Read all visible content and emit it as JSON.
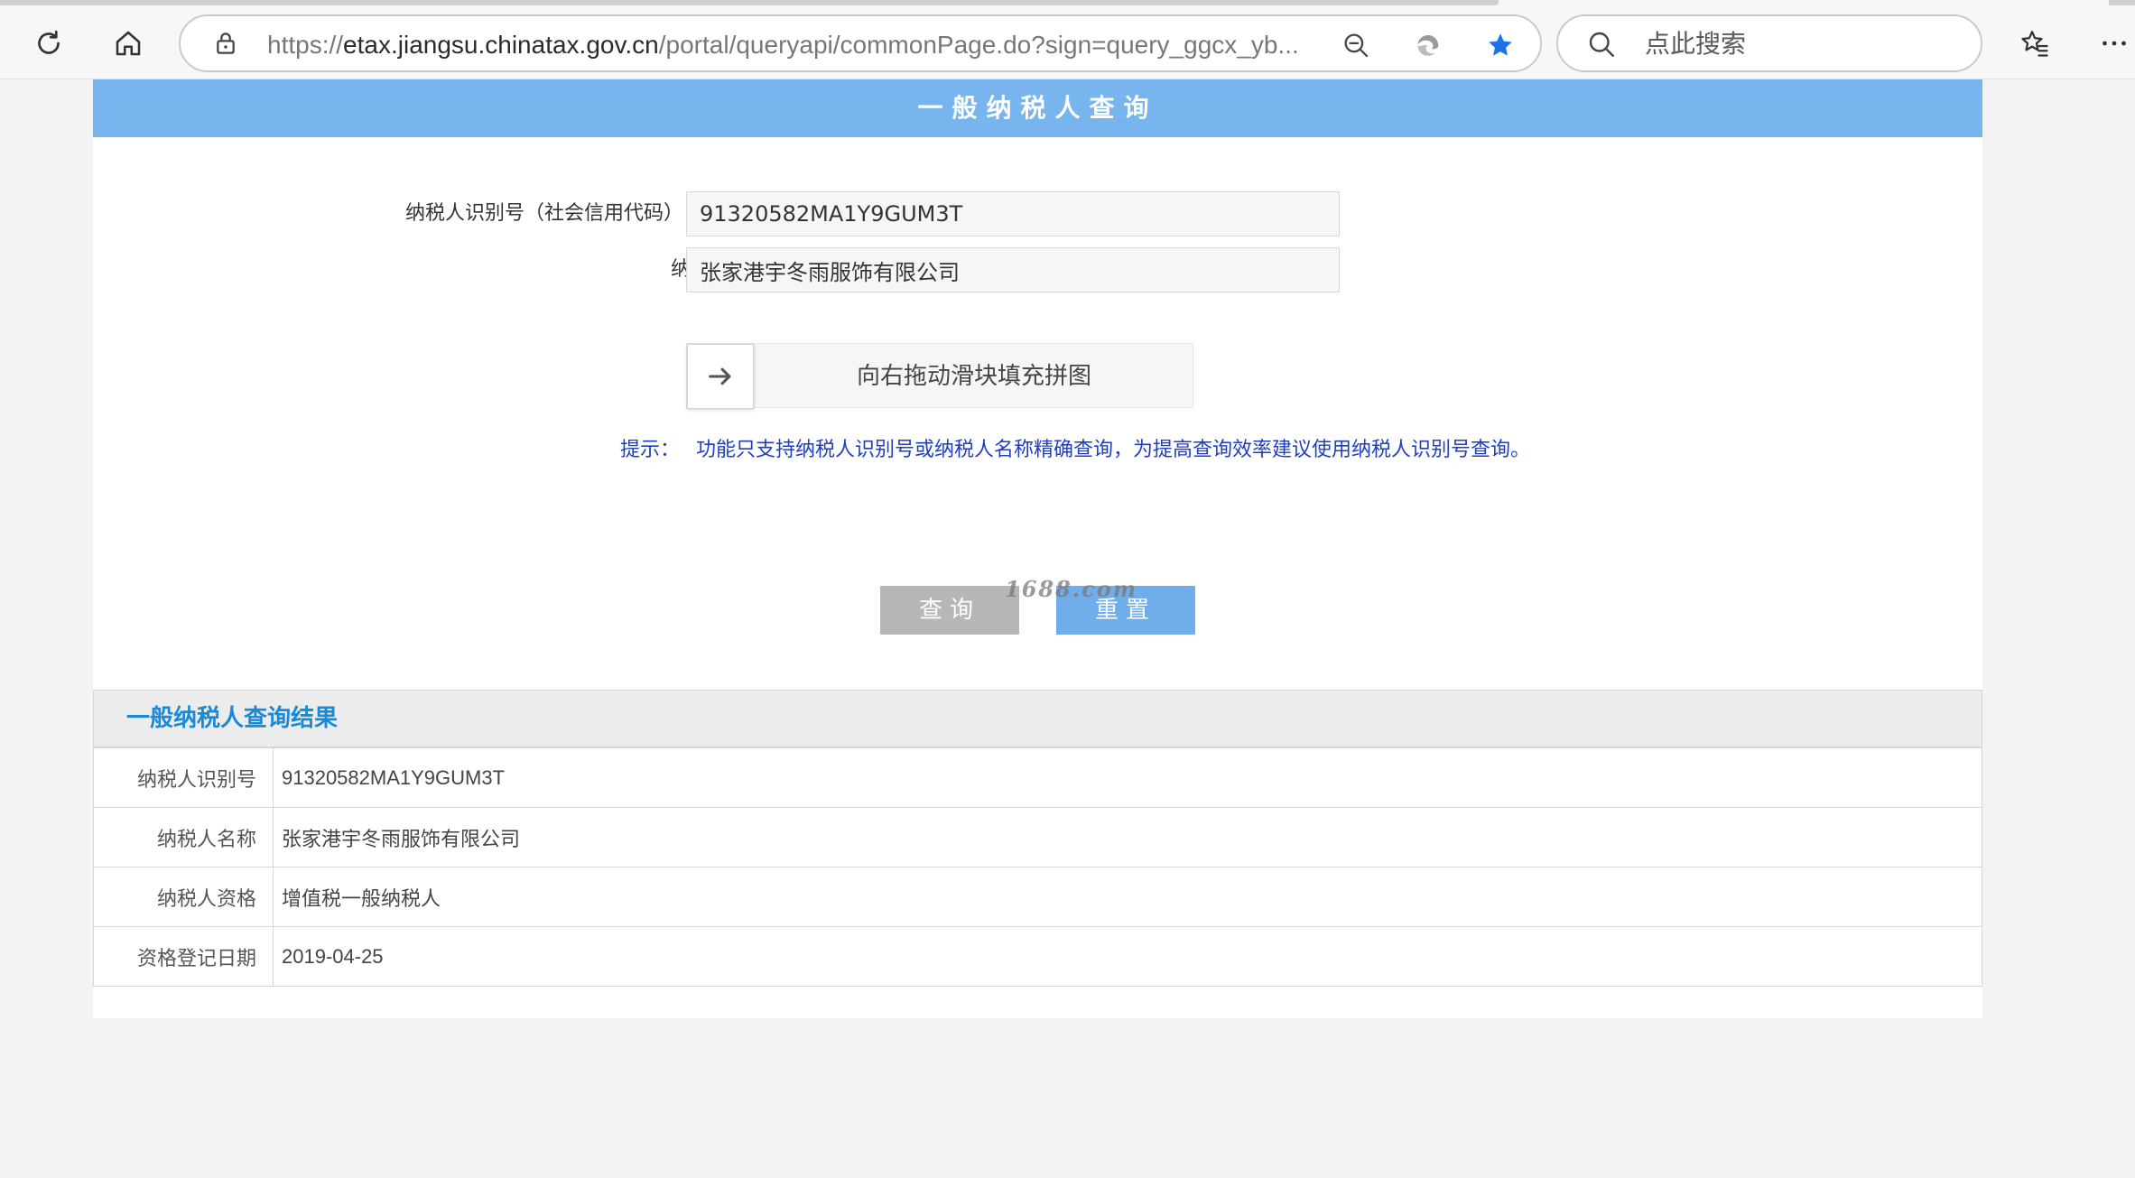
{
  "browser": {
    "url_host_prefix": "https://",
    "url_host": "etax.jiangsu.chinatax.gov.cn",
    "url_path": "/portal/queryapi/commonPage.do?sign=query_ggcx_yb...",
    "search_placeholder": "点此搜索",
    "accent_color": "#1a73e8"
  },
  "page": {
    "header_title": "一般纳税人查询",
    "header_color": "#78b4ee",
    "form": {
      "id_label": "纳税人识别号（社会信用代码）",
      "id_value": "91320582MA1Y9GUM3T",
      "name_label": "纳税人名称",
      "name_value": "张家港宇冬雨服饰有限公司"
    },
    "slider": {
      "text": "向右拖动滑块填充拼图",
      "handle_icon": "arrow-right-icon"
    },
    "tip": {
      "label": "提示：",
      "text": "功能只支持纳税人识别号或纳税人名称精确查询，为提高查询效率建议使用纳税人识别号查询。"
    },
    "buttons": {
      "query": "查询",
      "reset": "重置"
    },
    "watermark": "1688.com",
    "result": {
      "title": "一般纳税人查询结果",
      "rows": [
        {
          "key": "纳税人识别号",
          "value": "91320582MA1Y9GUM3T"
        },
        {
          "key": "纳税人名称",
          "value": "张家港宇冬雨服饰有限公司"
        },
        {
          "key": "纳税人资格",
          "value": "增值税一般纳税人"
        },
        {
          "key": "资格登记日期",
          "value": "2019-04-25"
        }
      ]
    }
  }
}
